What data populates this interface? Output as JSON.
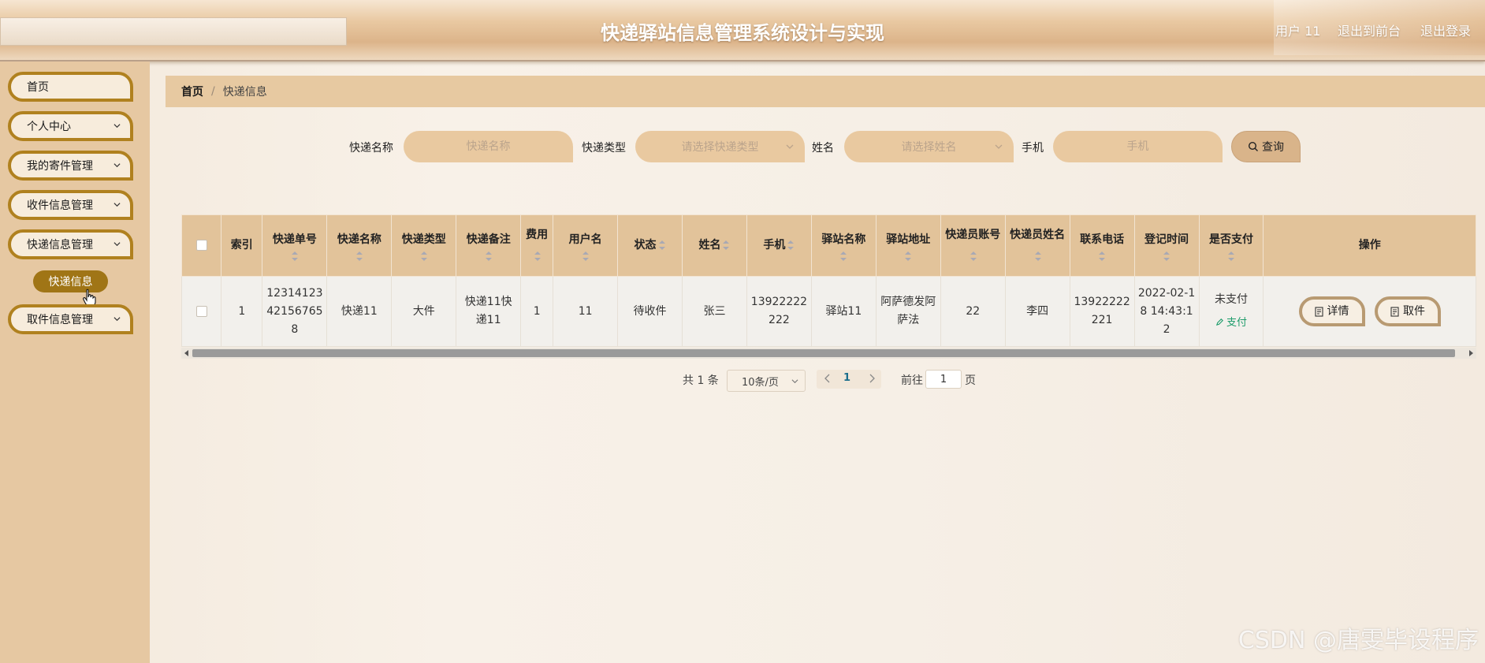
{
  "header": {
    "title": "快递驿站信息管理系统设计与实现",
    "user": "用户 11",
    "back_front": "退出到前台",
    "logout": "退出登录"
  },
  "sidebar": {
    "items": [
      {
        "label": "首页",
        "has_arrow": false
      },
      {
        "label": "个人中心",
        "has_arrow": true
      },
      {
        "label": "我的寄件管理",
        "has_arrow": true
      },
      {
        "label": "收件信息管理",
        "has_arrow": true
      },
      {
        "label": "快递信息管理",
        "has_arrow": true
      },
      {
        "label": "取件信息管理",
        "has_arrow": true
      }
    ],
    "active_sub": "快递信息"
  },
  "breadcrumb": {
    "home": "首页",
    "separator": "/",
    "current": "快递信息"
  },
  "search": {
    "name_label": "快递名称",
    "name_placeholder": "快递名称",
    "type_label": "快递类型",
    "type_placeholder": "请选择快递类型",
    "person_label": "姓名",
    "person_placeholder": "请选择姓名",
    "phone_label": "手机",
    "phone_placeholder": "手机",
    "button": "查询"
  },
  "table": {
    "columns": [
      "索引",
      "快递单号",
      "快递名称",
      "快递类型",
      "快递备注",
      "费用",
      "用户名",
      "状态",
      "姓名",
      "手机",
      "驿站名称",
      "驿站地址",
      "快递员账号",
      "快递员姓名",
      "联系电话",
      "登记时间",
      "是否支付",
      "操作"
    ],
    "rows": [
      {
        "index": "1",
        "tracking": "12314123421567658",
        "name": "快递11",
        "type": "大件",
        "remark": "快递11快递11",
        "fee": "1",
        "username": "11",
        "status": "待收件",
        "person": "张三",
        "phone": "13922222222",
        "station": "驿站11",
        "address": "阿萨德发阿萨法",
        "courier_account": "22",
        "courier_name": "李四",
        "contact": "13922222221",
        "reg_time": "2022-02-18 14:43:12",
        "paid": "未支付",
        "pay_action": "支付",
        "detail_btn": "详情",
        "pickup_btn": "取件"
      }
    ]
  },
  "pagination": {
    "total": "共 1 条",
    "page_size": "10条/页",
    "current_page": "1",
    "goto_label": "前往",
    "goto_value": "1",
    "page_label": "页"
  },
  "watermark": "CSDN @唐雯毕设程序",
  "colors": {
    "accent": "#a07516",
    "header_bg": "#dcb48a",
    "table_header_bg": "#e2c39a",
    "pay_link": "#1e9c6b"
  }
}
